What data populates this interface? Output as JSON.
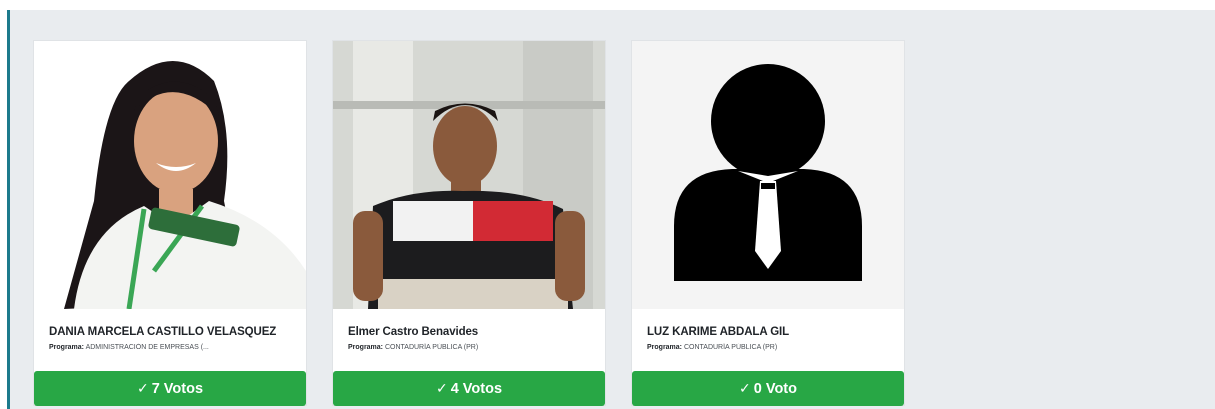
{
  "candidates": [
    {
      "name": "DANIA MARCELA CASTILLO VELASQUEZ",
      "program_label": "Programa:",
      "program": "ADMINISTRACIÓN DE EMPRESAS (...",
      "vote_label": "7 Votos",
      "photo": "candidate-photo"
    },
    {
      "name": "Elmer Castro Benavides",
      "program_label": "Programa:",
      "program": "CONTADURÍA PÚBLICA (PR)",
      "vote_label": "4 Votos",
      "photo": "candidate-photo"
    },
    {
      "name": "LUZ KARIME ABDALA GIL",
      "program_label": "Programa:",
      "program": "CONTADURÍA PÚBLICA (PR)",
      "vote_label": "0 Voto",
      "photo": "placeholder-person-icon"
    }
  ],
  "icons": {
    "vote": "check-icon"
  },
  "colors": {
    "vote_button": "#28a745",
    "panel_bg": "#e9ecef",
    "accent_border": "#1c7a8c"
  }
}
